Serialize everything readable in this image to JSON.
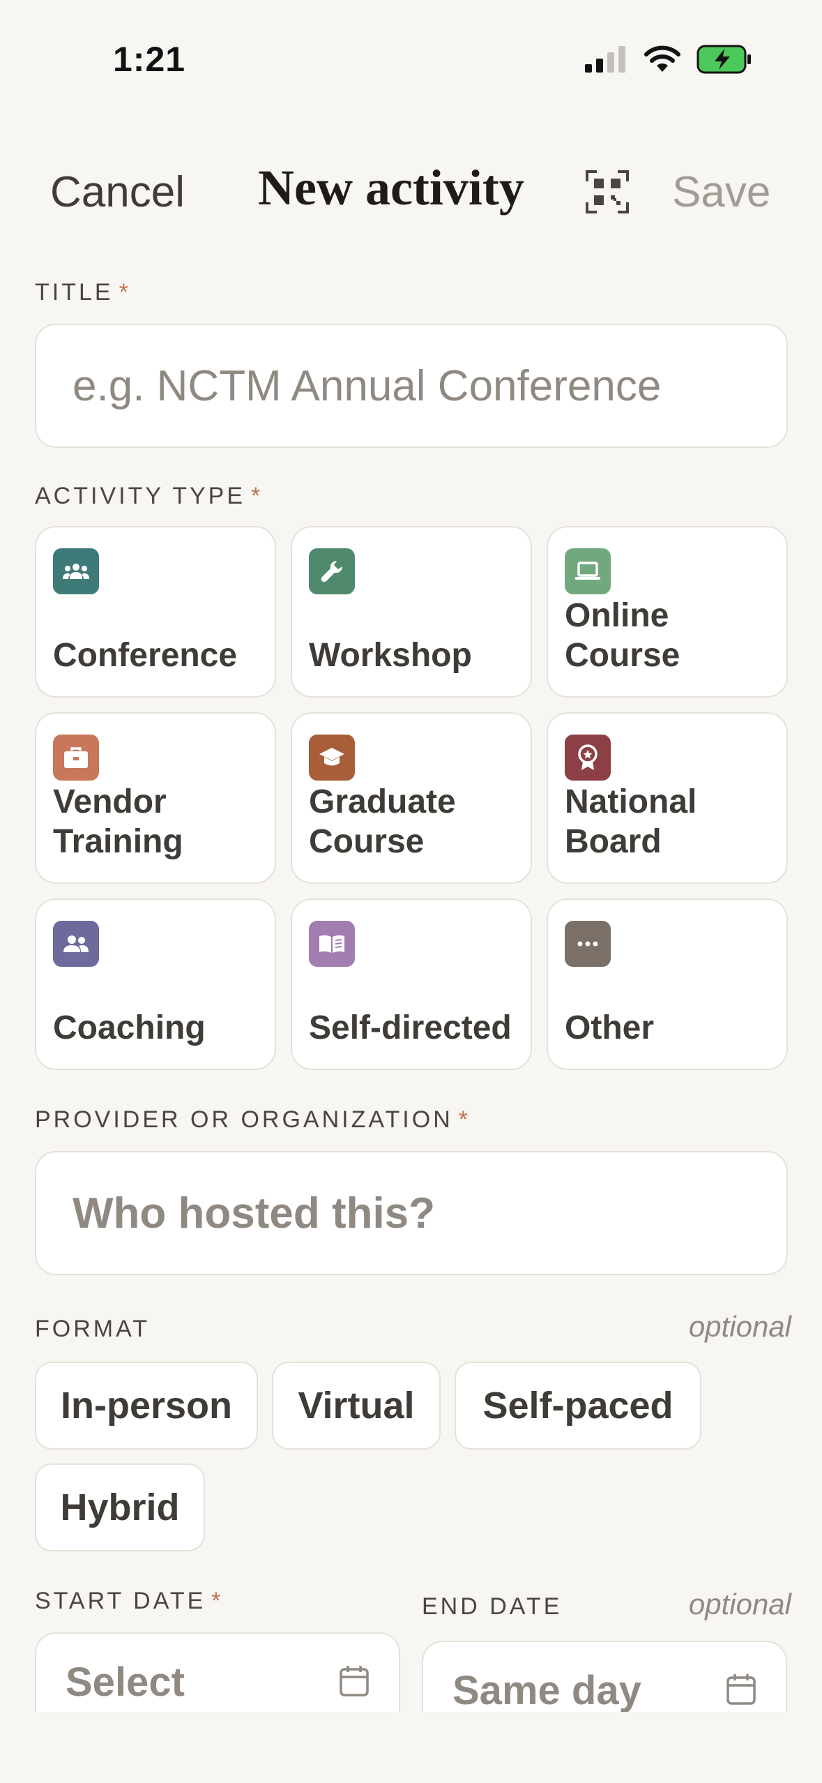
{
  "status": {
    "time": "1:21"
  },
  "nav": {
    "cancel": "Cancel",
    "title": "New activity",
    "save": "Save",
    "qr_icon": "qr-code-scan-icon"
  },
  "title_field": {
    "label": "TITLE",
    "required": "*",
    "placeholder": "e.g. NCTM Annual Conference"
  },
  "activity_type": {
    "label": "ACTIVITY TYPE",
    "required": "*",
    "options": [
      {
        "label": "Conference",
        "icon": "group-icon",
        "color": "#3E7B78"
      },
      {
        "label": "Workshop",
        "icon": "wrench-icon",
        "color": "#4F8A6C"
      },
      {
        "label": "Online Course",
        "icon": "laptop-icon",
        "color": "#72A87E"
      },
      {
        "label": "Vendor Training",
        "icon": "briefcase-icon",
        "color": "#C8775A"
      },
      {
        "label": "Graduate Course",
        "icon": "graduation-cap-icon",
        "color": "#A85E38"
      },
      {
        "label": "National Board",
        "icon": "award-badge-icon",
        "color": "#8C3F45"
      },
      {
        "label": "Coaching",
        "icon": "people-icon",
        "color": "#6D6A9C"
      },
      {
        "label": "Self-directed",
        "icon": "book-icon",
        "color": "#A27DB0"
      },
      {
        "label": "Other",
        "icon": "more-dots-icon",
        "color": "#7A7068"
      }
    ]
  },
  "provider": {
    "label": "PROVIDER OR ORGANIZATION",
    "required": "*",
    "placeholder": "Who hosted this?"
  },
  "format": {
    "label": "FORMAT",
    "optional": "optional",
    "options": [
      "In-person",
      "Virtual",
      "Self-paced",
      "Hybrid"
    ]
  },
  "start_date": {
    "label": "START DATE",
    "required": "*",
    "placeholder": "Select"
  },
  "end_date": {
    "label": "END DATE",
    "optional": "optional",
    "placeholder": "Same day"
  },
  "colors": {
    "background": "#F8F6F2",
    "accent_required": "#C0724E",
    "battery": "#4CC95A"
  }
}
